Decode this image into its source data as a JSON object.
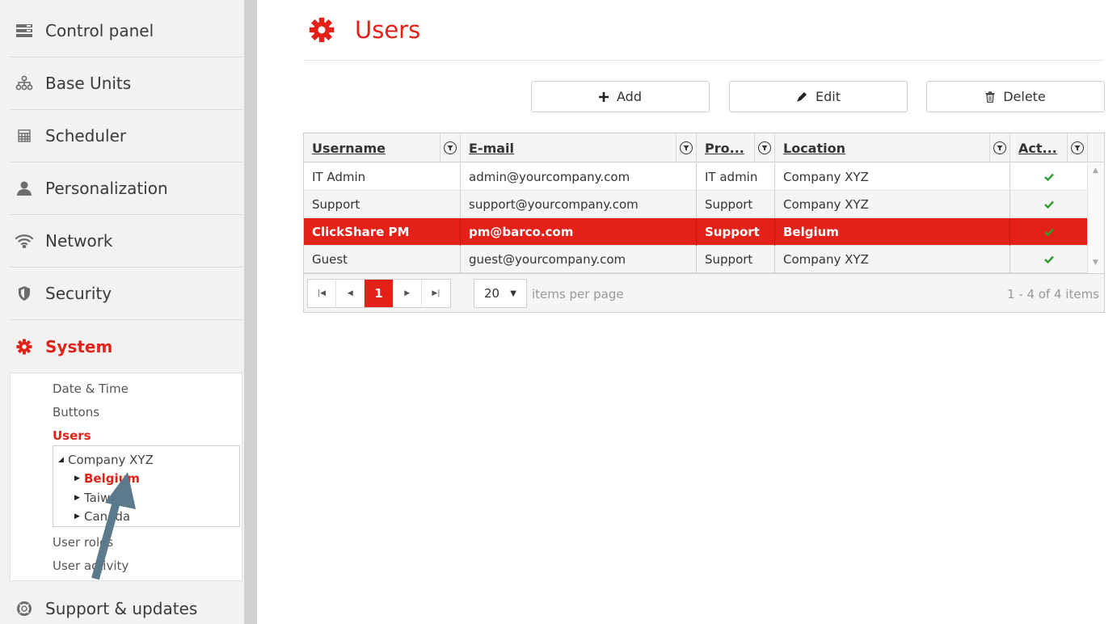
{
  "sidebar": {
    "items": [
      {
        "label": "Control panel",
        "icon": "control-panel-icon"
      },
      {
        "label": "Base Units",
        "icon": "network-tree-icon"
      },
      {
        "label": "Scheduler",
        "icon": "calendar-icon"
      },
      {
        "label": "Personalization",
        "icon": "person-icon"
      },
      {
        "label": "Network",
        "icon": "wifi-icon"
      },
      {
        "label": "Security",
        "icon": "shield-icon"
      },
      {
        "label": "System",
        "icon": "gear-icon",
        "active": true
      },
      {
        "label": "Support & updates",
        "icon": "lifebuoy-icon"
      }
    ],
    "system_submenu": [
      {
        "label": "Date & Time"
      },
      {
        "label": "Buttons"
      },
      {
        "label": "Users",
        "active": true
      },
      {
        "label": "User roles"
      },
      {
        "label": "User activity"
      }
    ],
    "tree": {
      "root": "Company XYZ",
      "children": [
        {
          "label": "Belgium",
          "active": true
        },
        {
          "label": "Taiwan"
        },
        {
          "label": "Canada"
        }
      ]
    }
  },
  "page": {
    "title": "Users",
    "title_icon": "gear-icon"
  },
  "toolbar": {
    "add_label": "Add",
    "edit_label": "Edit",
    "delete_label": "Delete"
  },
  "grid": {
    "columns": [
      "Username",
      "E-mail",
      "Pro...",
      "Location",
      "Act..."
    ],
    "rows": [
      {
        "username": "IT Admin",
        "email": "admin@yourcompany.com",
        "profile": "IT admin",
        "location": "Company XYZ",
        "active": true
      },
      {
        "username": "Support",
        "email": "support@yourcompany.com",
        "profile": "Support",
        "location": "Company XYZ",
        "active": true
      },
      {
        "username": "ClickShare PM",
        "email": "pm@barco.com",
        "profile": "Support",
        "location": "Belgium",
        "active": true,
        "selected": true
      },
      {
        "username": "Guest",
        "email": "guest@yourcompany.com",
        "profile": "Support",
        "location": "Company XYZ",
        "active": true
      }
    ],
    "pager": {
      "current_page": "1",
      "page_size": "20",
      "items_per_page_label": "items per page",
      "info": "1 - 4 of 4 items"
    }
  },
  "colors": {
    "accent": "#e32119",
    "check": "#2e9e2e",
    "annotation_arrow": "#5b7a8c"
  }
}
